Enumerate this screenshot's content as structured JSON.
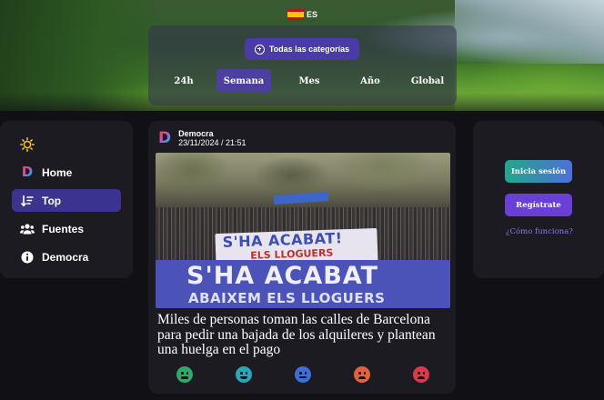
{
  "header": {
    "language": "ES",
    "category_button": "Todas las categorías",
    "tabs": [
      {
        "label": "24h",
        "active": false
      },
      {
        "label": "Semana",
        "active": true
      },
      {
        "label": "Mes",
        "active": false
      },
      {
        "label": "Año",
        "active": false
      },
      {
        "label": "Global",
        "active": false
      }
    ]
  },
  "sidebar": {
    "theme_icon": "sun-icon",
    "items": [
      {
        "label": "Home",
        "icon": "democra-logo-icon",
        "active": false
      },
      {
        "label": "Top",
        "icon": "sort-icon",
        "active": true
      },
      {
        "label": "Fuentes",
        "icon": "users-icon",
        "active": false
      },
      {
        "label": "Democra",
        "icon": "info-icon",
        "active": false
      }
    ]
  },
  "post": {
    "source": "Democra",
    "date": "23/11/2024 / 21:51",
    "title": "Miles de personas toman las calles de Barcelona para pedir una bajada de los alquileres y plantean una huelga en el pago",
    "image_text": {
      "banner_small": "S'HA ACABAT!",
      "banner_small_sub": "ELS LLOGUERS",
      "banner_main": "S'HA ACABAT",
      "banner_main_sub": "ABAIXEM ELS LLOGUERS"
    },
    "reactions": [
      {
        "icon": "nauseated-face-icon",
        "color": "#2fa86a"
      },
      {
        "icon": "grinning-face-icon",
        "color": "#2aa6b8"
      },
      {
        "icon": "neutral-face-icon",
        "color": "#3b6fd6"
      },
      {
        "icon": "frowning-face-icon",
        "color": "#e2623a"
      },
      {
        "icon": "angry-face-icon",
        "color": "#d83a4a"
      }
    ]
  },
  "auth": {
    "login": "Inicia sesión",
    "register": "Regístrate",
    "how": "¿Cómo funciona?"
  },
  "colors": {
    "accent": "#4d3fa0",
    "background": "#111014",
    "panel": "#1d1b22",
    "link": "#8a77e8"
  }
}
